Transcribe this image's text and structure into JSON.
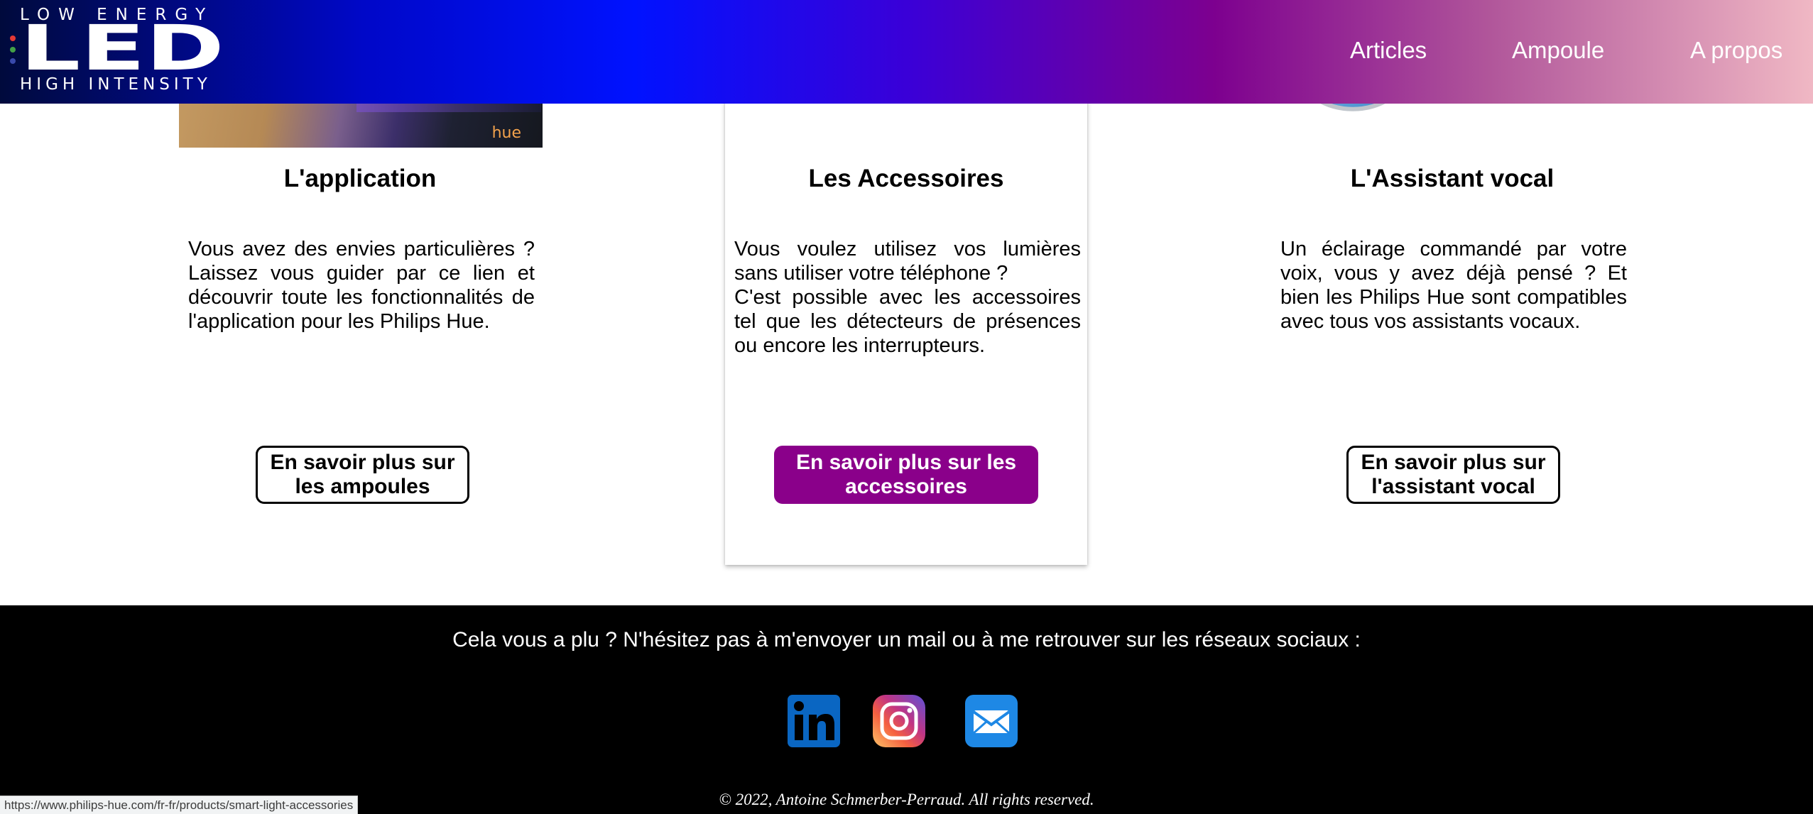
{
  "header": {
    "logo": {
      "top_text": "LOW ENERGY",
      "main_text": "LED",
      "bottom_text": "HIGH INTENSITY"
    },
    "nav": {
      "articles": "Articles",
      "ampoule": "Ampoule",
      "apropos": "A propos"
    }
  },
  "cards": [
    {
      "title": "L'application",
      "text": "Vous avez des envies particulières ? Laissez vous guider par ce lien et découvrir toute les fonctionnalités de l'application pour les Philips Hue.",
      "button": "En savoir plus sur les ampoules",
      "image_label": "hue"
    },
    {
      "title": "Les Accessoires",
      "text": "Vous voulez utilisez vos lumières sans utiliser votre téléphone ?\nC'est possible avec les accessoires tel que les détecteurs de présences ou encore les interrupteurs.",
      "button": "En savoir plus sur les accessoires"
    },
    {
      "title": "L'Assistant vocal",
      "text": "Un éclairage commandé par votre voix, vous y avez déjà pensé ? Et bien les Philips Hue sont compatibles avec tous vos assistants vocaux.",
      "button": "En savoir plus sur l'assistant vocal"
    }
  ],
  "footer": {
    "text": "Cela vous a plu ? N'hésitez pas à m'envoyer un mail ou à me retrouver sur les réseaux sociaux :",
    "social": [
      "linkedin-icon",
      "instagram-icon",
      "mail-icon"
    ],
    "copyright": "© 2022, Antoine Schmerber-Perraud. All rights reserved."
  },
  "status_bar": {
    "url": "https://www.philips-hue.com/fr-fr/products/smart-light-accessories"
  },
  "colors": {
    "accent_button": "#8a008a",
    "footer_bg": "#000000",
    "linkedin": "#0a66c2",
    "mail": "#1e88e5"
  }
}
